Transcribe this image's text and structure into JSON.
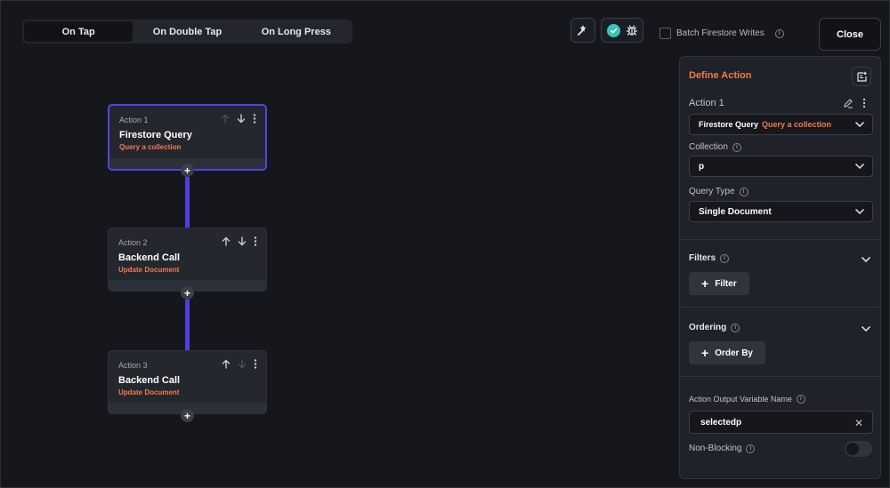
{
  "tabs": [
    {
      "label": "On Tap",
      "active": true
    },
    {
      "label": "On Double Tap",
      "active": false
    },
    {
      "label": "On Long Press",
      "active": false
    }
  ],
  "toolbar": {
    "batch_label": "Batch Firestore Writes",
    "close_label": "Close"
  },
  "actions": [
    {
      "label": "Action 1",
      "title": "Firestore Query",
      "subtitle": "Query a collection"
    },
    {
      "label": "Action 2",
      "title": "Backend Call",
      "subtitle": "Update Document"
    },
    {
      "label": "Action 3",
      "title": "Backend Call",
      "subtitle": "Update Document"
    }
  ],
  "panel": {
    "title": "Define Action",
    "action_label": "Action 1",
    "action_type": "Firestore Query",
    "action_type_detail": "Query a collection",
    "collection_label": "Collection",
    "collection_value": "p",
    "query_type_label": "Query Type",
    "query_type_value": "Single Document",
    "filters_label": "Filters",
    "filter_button": "Filter",
    "ordering_label": "Ordering",
    "order_button": "Order By",
    "output_label": "Action Output Variable Name",
    "output_value": "selectedp",
    "non_blocking_label": "Non-Blocking",
    "non_blocking_on": false
  },
  "colors": {
    "accent_orange": "#f07b4f",
    "connector_purple": "#4f3fe0",
    "success_teal": "#39c6b6"
  }
}
